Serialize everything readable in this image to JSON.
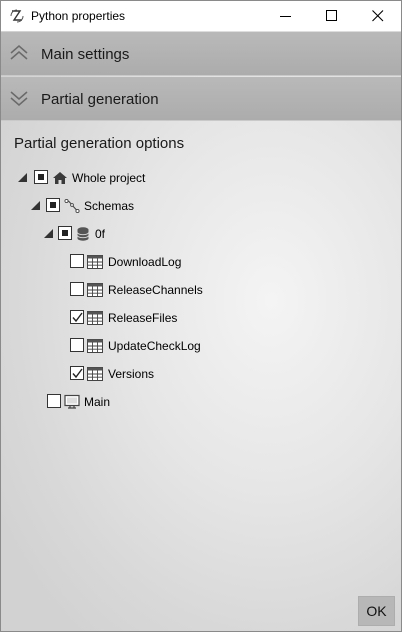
{
  "window": {
    "title": "Python properties",
    "icons": [
      "python-app-icon",
      "minimize-icon",
      "maximize-icon",
      "close-icon"
    ]
  },
  "accordion": {
    "main_settings": {
      "label": "Main settings",
      "icon": "chevron-double-up-icon"
    },
    "partial_generation": {
      "label": "Partial generation",
      "icon": "chevron-double-down-icon"
    }
  },
  "partial": {
    "title": "Partial generation options",
    "tree": {
      "whole_project": {
        "label": "Whole project",
        "state": "indeterminate",
        "icon": "home-icon",
        "expanded": true
      },
      "schemas": {
        "label": "Schemas",
        "state": "indeterminate",
        "icon": "schema-icon",
        "expanded": true
      },
      "db": {
        "label": "0f",
        "state": "indeterminate",
        "icon": "database-icon",
        "expanded": true
      },
      "tables": [
        {
          "label": "DownloadLog",
          "checked": false,
          "icon": "table-icon"
        },
        {
          "label": "ReleaseChannels",
          "checked": false,
          "icon": "table-icon"
        },
        {
          "label": "ReleaseFiles",
          "checked": true,
          "icon": "table-icon"
        },
        {
          "label": "UpdateCheckLog",
          "checked": false,
          "icon": "table-icon"
        },
        {
          "label": "Versions",
          "checked": true,
          "icon": "table-icon"
        }
      ],
      "main": {
        "label": "Main",
        "checked": false,
        "icon": "monitor-icon"
      }
    }
  },
  "footer": {
    "ok_label": "OK"
  }
}
